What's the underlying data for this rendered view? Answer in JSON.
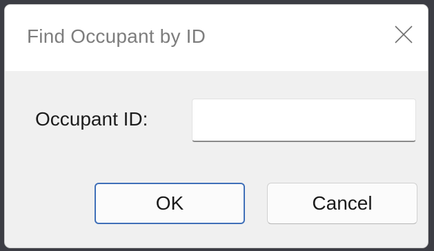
{
  "dialog": {
    "title": "Find Occupant by ID",
    "close_icon": "close-icon"
  },
  "form": {
    "occupant_label": "Occupant ID:",
    "occupant_value": "",
    "occupant_placeholder": ""
  },
  "buttons": {
    "ok_label": "OK",
    "cancel_label": "Cancel"
  },
  "colors": {
    "dialog_background": "#f0f0f0",
    "titlebar_background": "#ffffff",
    "focus_accent": "#3f6fb8"
  }
}
